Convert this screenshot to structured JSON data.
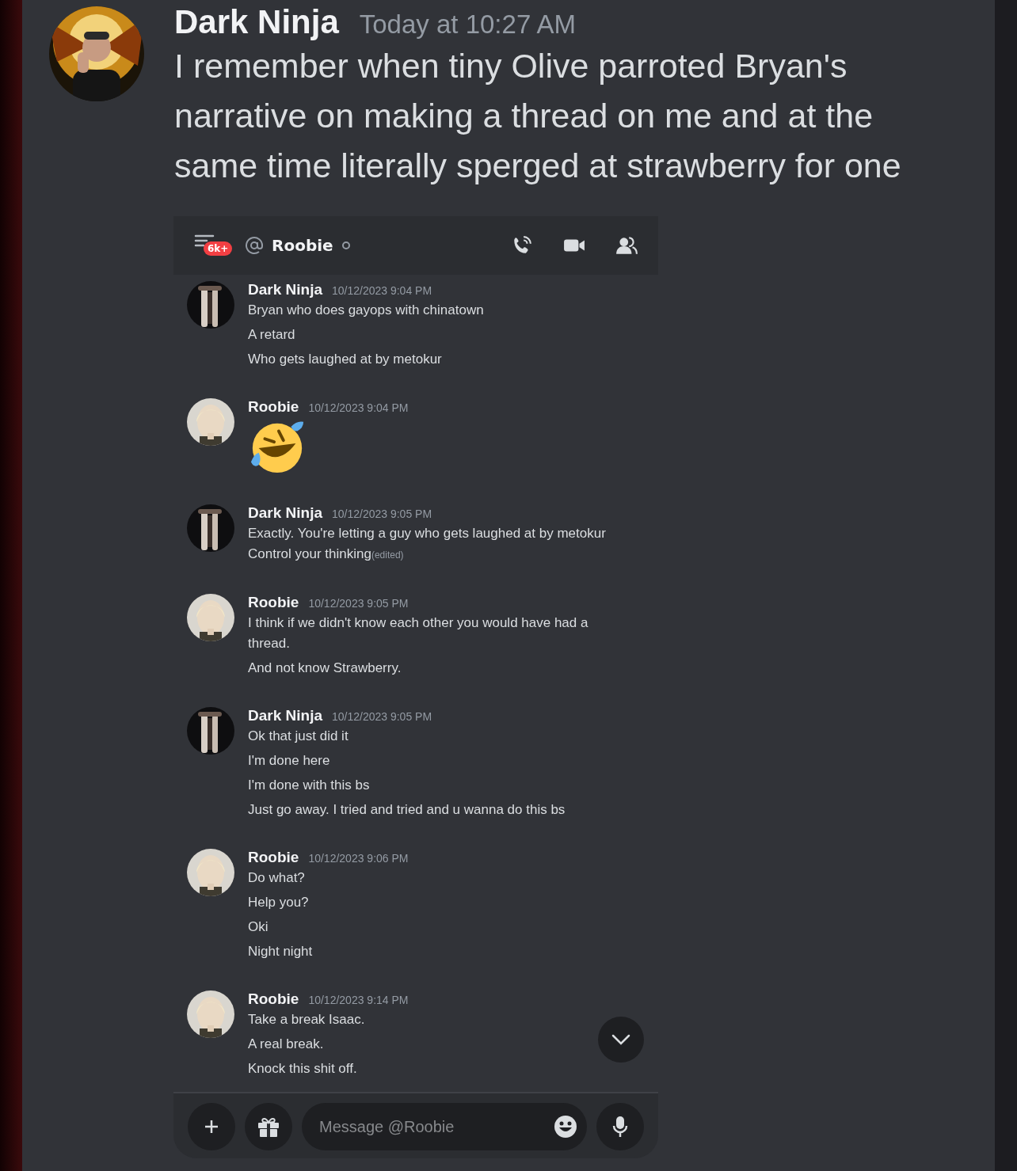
{
  "post": {
    "author": "Dark Ninja",
    "time": "Today at 10:27 AM",
    "text": "I remember when tiny Olive parroted Bryan's narrative on making a thread on me and at the same time literally sperged at strawberry for one"
  },
  "embed": {
    "header": {
      "badge": "6k+",
      "name": "Roobie"
    },
    "messages": [
      {
        "author": "Dark Ninja",
        "time": "10/12/2023 9:04 PM",
        "lines": [
          {
            "kind": "text",
            "text": "Bryan who does gayops with chinatown"
          },
          {
            "kind": "text",
            "text": "A retard"
          },
          {
            "kind": "text",
            "text": "Who gets laughed at by metokur"
          }
        ]
      },
      {
        "author": "Roobie",
        "time": "10/12/2023 9:04 PM",
        "lines": [
          {
            "kind": "emoji"
          }
        ]
      },
      {
        "author": "Dark Ninja",
        "time": "10/12/2023 9:05 PM",
        "lines": [
          {
            "kind": "text",
            "text": "Exactly. You're letting a guy who gets laughed at by metokur Control your thinking",
            "edited": "(edited)"
          }
        ]
      },
      {
        "author": "Roobie",
        "time": "10/12/2023 9:05 PM",
        "lines": [
          {
            "kind": "text",
            "text": "I think if we didn't know each other you would have had a thread."
          },
          {
            "kind": "text",
            "text": "And not know Strawberry."
          }
        ]
      },
      {
        "author": "Dark Ninja",
        "time": "10/12/2023 9:05 PM",
        "lines": [
          {
            "kind": "text",
            "text": "Ok that just did it"
          },
          {
            "kind": "text",
            "text": "I'm done here"
          },
          {
            "kind": "text",
            "text": "I'm done with this bs"
          },
          {
            "kind": "text",
            "text": "Just go away. I tried and tried and u wanna do this bs"
          }
        ]
      },
      {
        "author": "Roobie",
        "time": "10/12/2023 9:06 PM",
        "lines": [
          {
            "kind": "text",
            "text": "Do what?"
          },
          {
            "kind": "text",
            "text": "Help you?"
          },
          {
            "kind": "text",
            "text": "Oki"
          },
          {
            "kind": "text",
            "text": "Night night"
          }
        ]
      },
      {
        "author": "Roobie",
        "time": "10/12/2023 9:14 PM",
        "lines": [
          {
            "kind": "text",
            "text": "Take a break Isaac."
          },
          {
            "kind": "text",
            "text": "A real break."
          },
          {
            "kind": "text",
            "text": "Knock this shit off."
          }
        ]
      }
    ],
    "composer": {
      "placeholder": "Message @Roobie"
    }
  }
}
